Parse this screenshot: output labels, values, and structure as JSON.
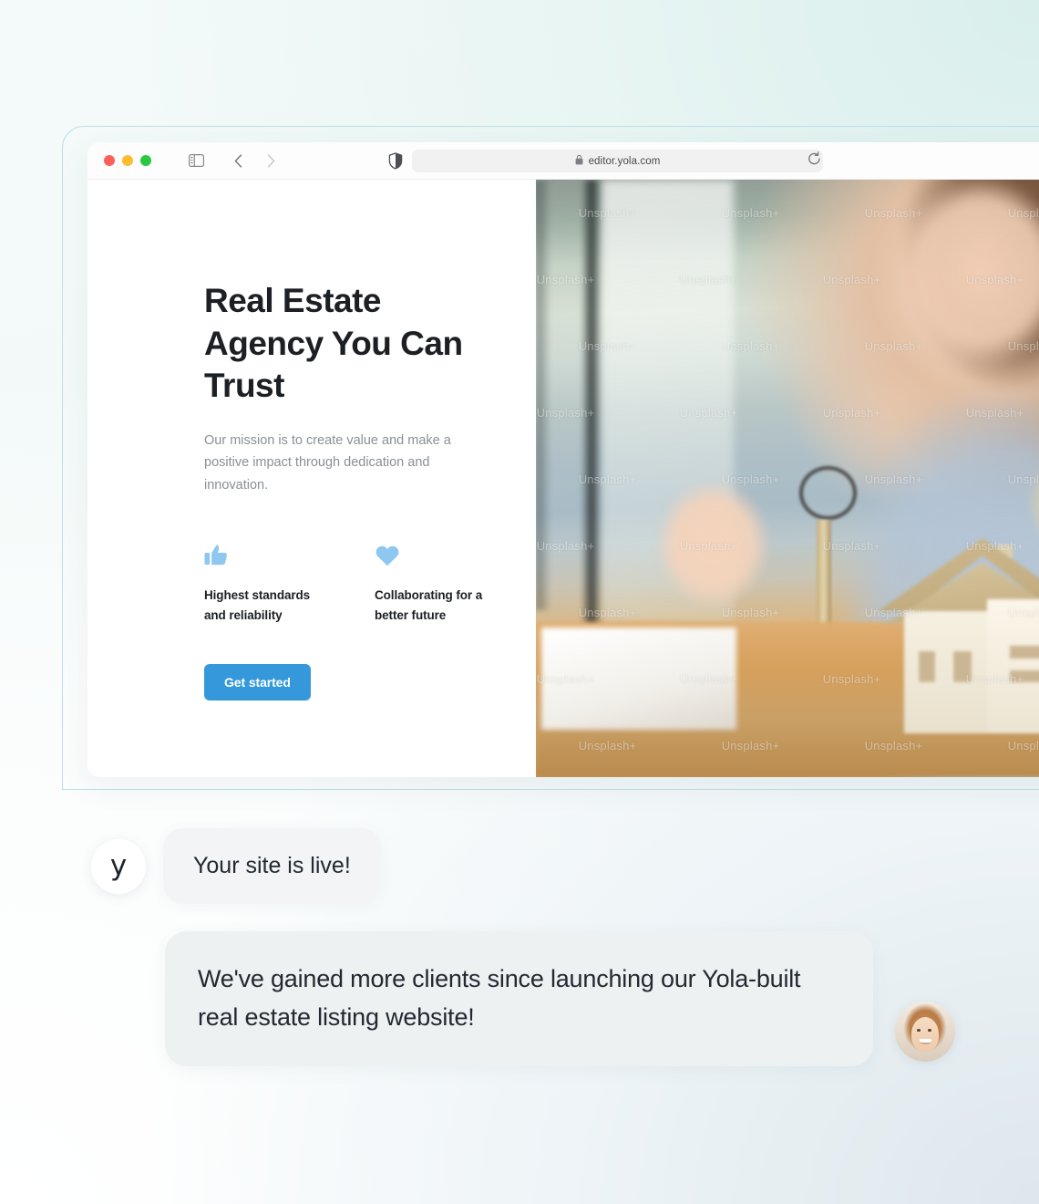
{
  "browser": {
    "traffic_lights": [
      "close",
      "minimize",
      "zoom"
    ],
    "sidebar_toggle_icon": "sidebar-toggle-icon",
    "back_icon": "chevron-left-icon",
    "forward_icon": "chevron-right-icon",
    "shield_icon": "shield-icon",
    "lock_icon": "lock-icon",
    "url": "editor.yola.com",
    "reload_icon": "reload-icon"
  },
  "site": {
    "title": "Real Estate Agency You Can Trust",
    "subtitle": "Our mission is to create value and make a positive impact through dedication and innovation.",
    "features": [
      {
        "icon": "thumbs-up-icon",
        "label": "Highest standards and reliability"
      },
      {
        "icon": "heart-icon",
        "label": "Collaborating for a better future"
      }
    ],
    "cta_label": "Get started",
    "hero_image_watermark": "Unsplash+",
    "accent_color": "#3498db",
    "icon_color": "#8ec8f0"
  },
  "chat": {
    "yola_logo": "y",
    "message_1": "Your site is live!",
    "message_2": "We've gained more clients since launching our Yola-built real estate listing website!",
    "client_avatar": "client-avatar-photo"
  }
}
